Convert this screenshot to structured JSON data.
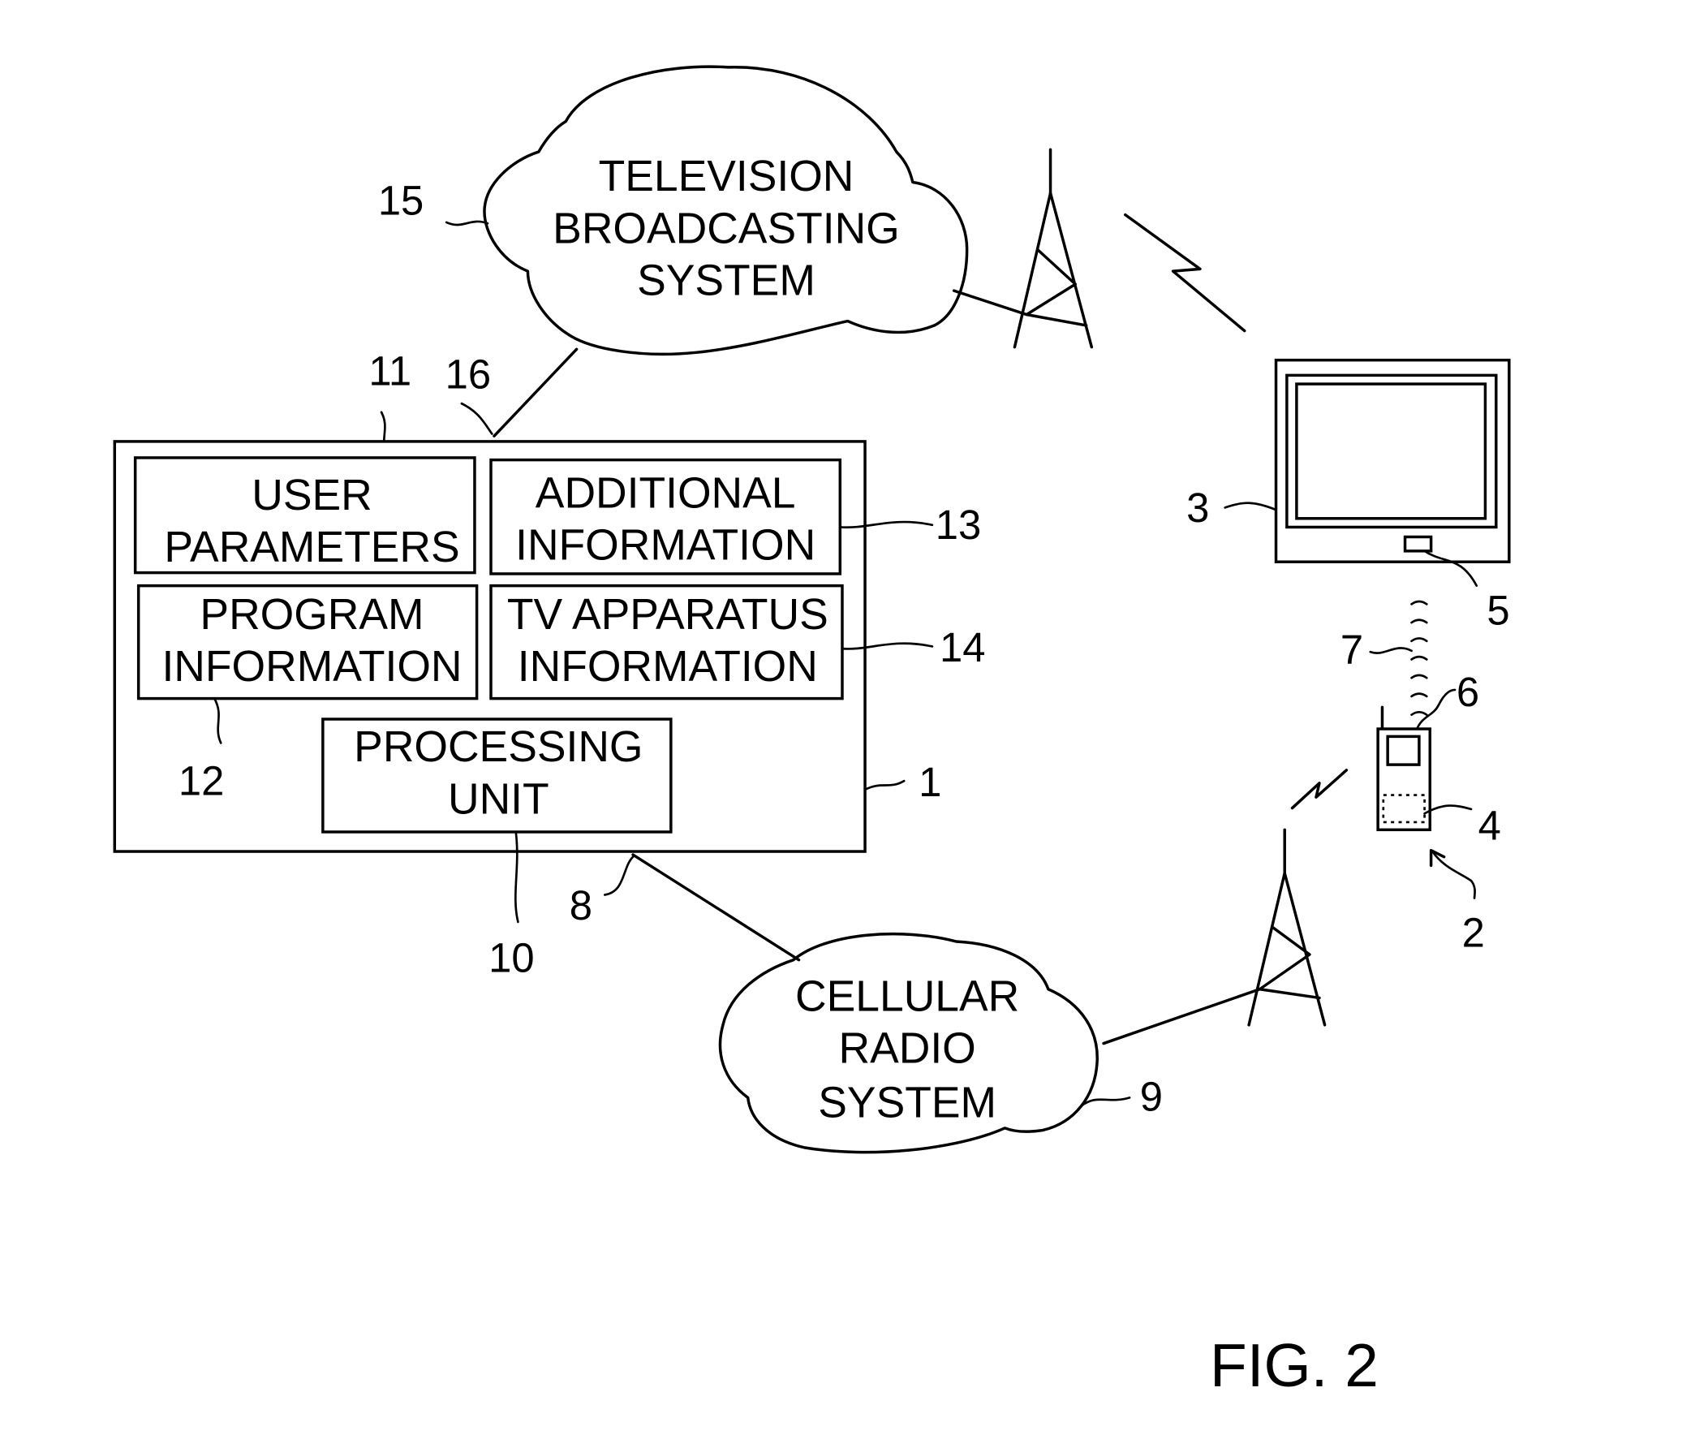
{
  "figure": {
    "caption": "FIG. 2",
    "clouds": {
      "television": [
        "TELEVISION",
        "BROADCASTING",
        "SYSTEM"
      ],
      "cellular": [
        "CELLULAR",
        "RADIO",
        "SYSTEM"
      ]
    },
    "server_blocks": {
      "user_parameters": [
        "USER",
        "PARAMETERS"
      ],
      "additional_information": [
        "ADDITIONAL",
        "INFORMATION"
      ],
      "program_information": [
        "PROGRAM",
        "INFORMATION"
      ],
      "tv_apparatus_information": [
        "TV APPARATUS",
        "INFORMATION"
      ],
      "processing_unit": [
        "PROCESSING",
        "UNIT"
      ]
    },
    "reference_numerals": {
      "server": "1",
      "mobile_terminal": "2",
      "tv_apparatus": "3",
      "terminal_memory": "4",
      "tv_receiver": "5",
      "terminal_transmitter": "6",
      "short_range_link": "7",
      "cellular_connection": "8",
      "cellular_system": "9",
      "processing_unit": "10",
      "user_parameters": "11",
      "program_information": "12",
      "additional_information": "13",
      "tv_apparatus_information": "14",
      "tv_broadcasting_system": "15",
      "broadcast_connection": "16"
    }
  }
}
